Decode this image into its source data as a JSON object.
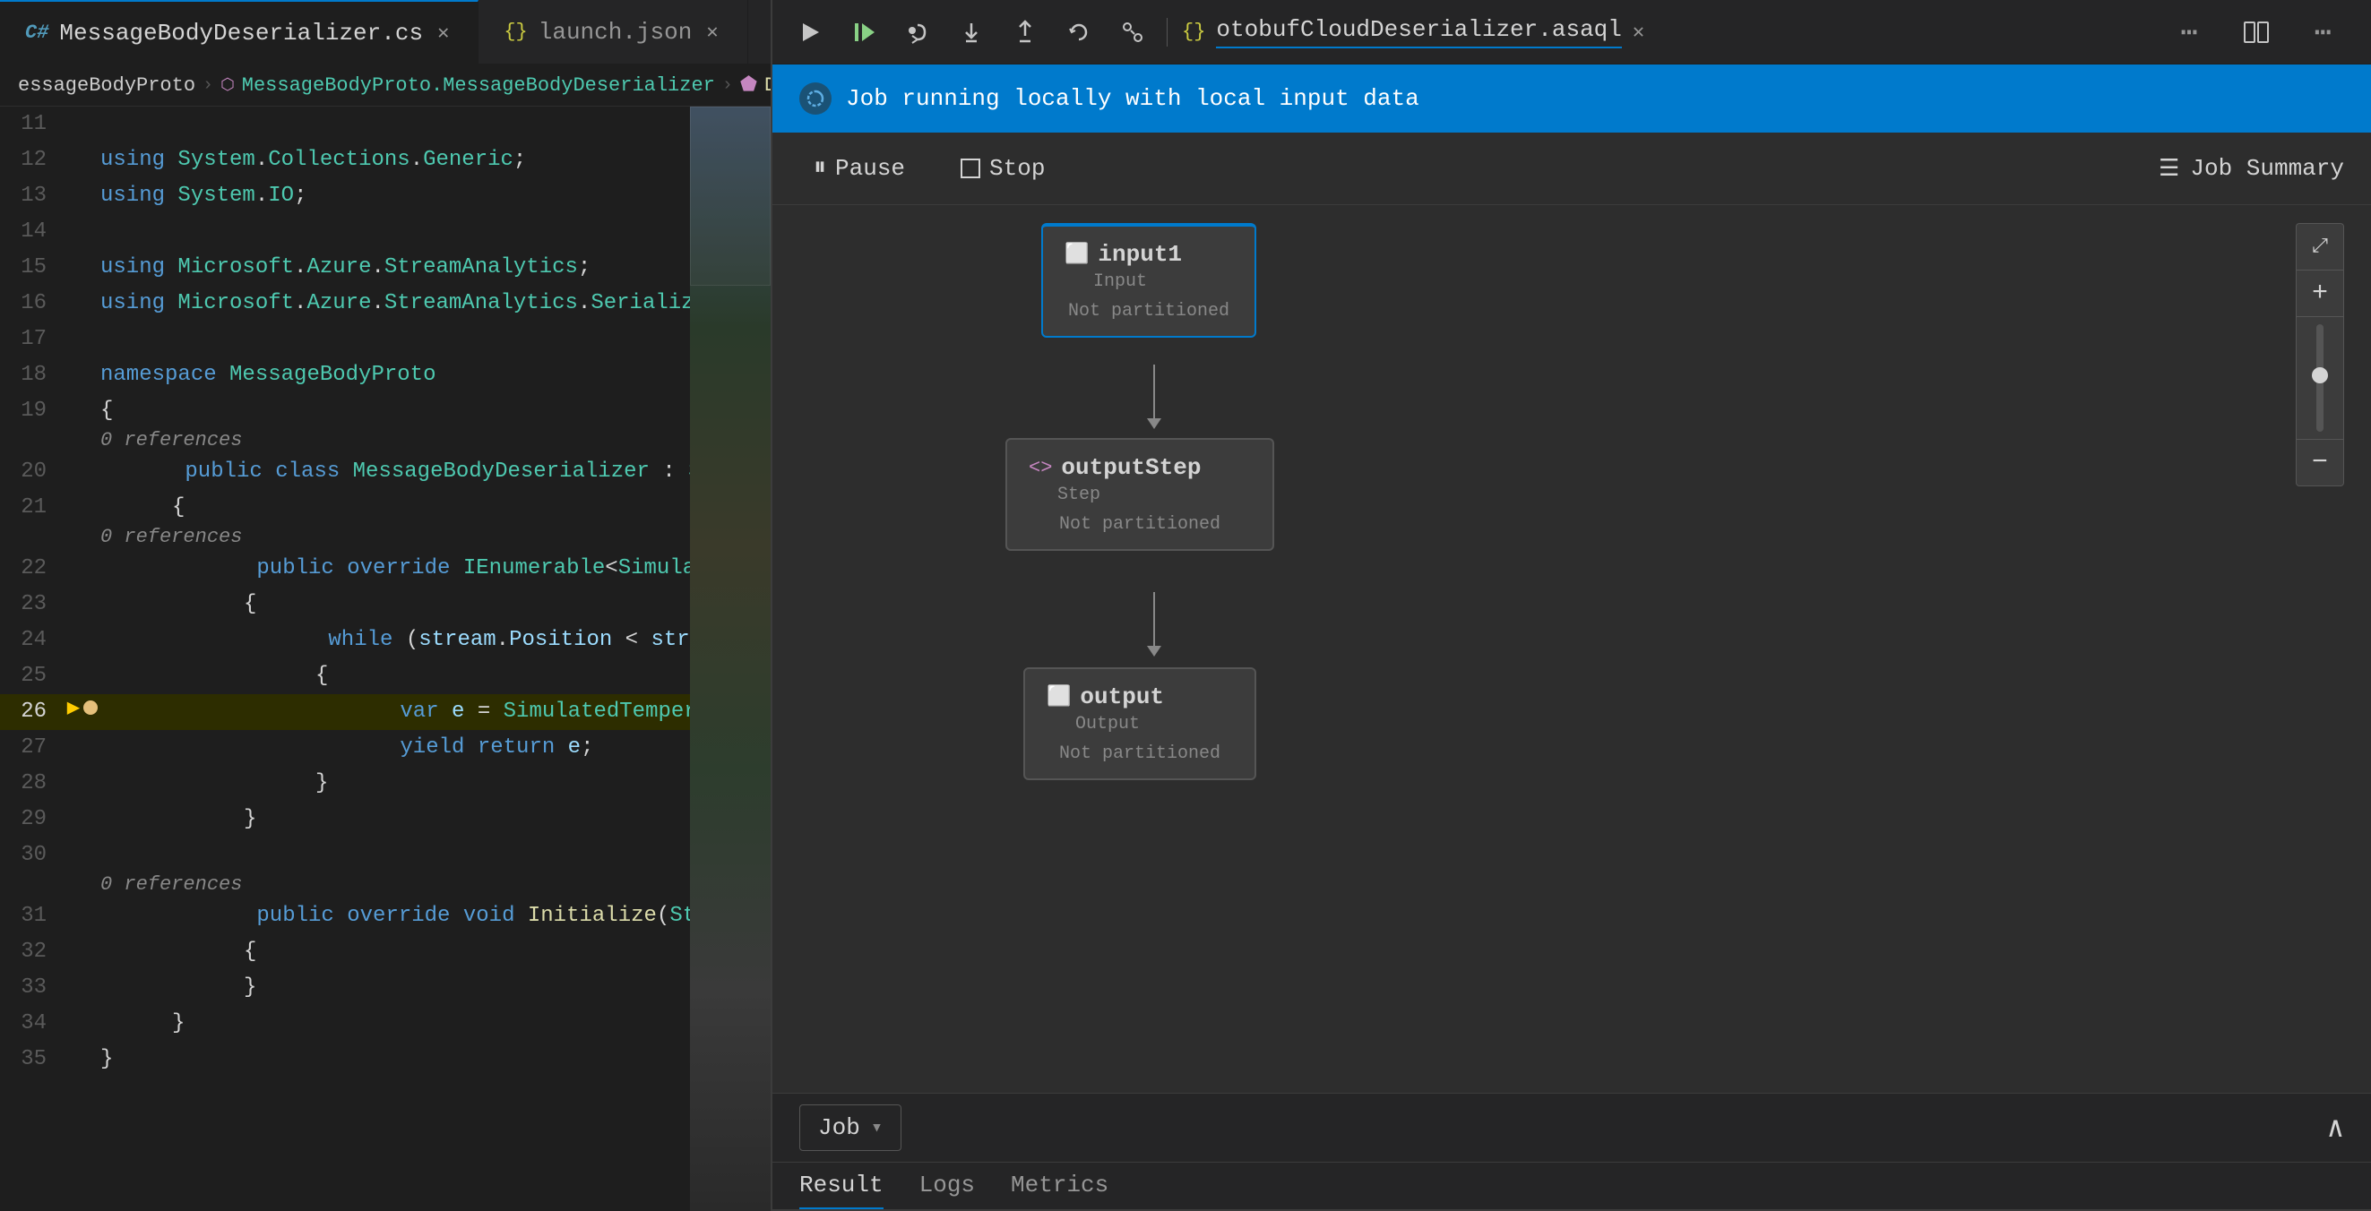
{
  "tabs": {
    "left": [
      {
        "id": "cs-file",
        "icon": "cs",
        "label": "MessageBodyDeserializer.cs",
        "active": true
      },
      {
        "id": "json-file",
        "icon": "json",
        "label": "launch.json",
        "active": false
      }
    ],
    "right": [
      {
        "id": "asaql-file",
        "icon": "asaql",
        "label": "otobufCloudDeserializer.asaql",
        "active": true
      }
    ],
    "more_label": "..."
  },
  "breadcrumb": {
    "parts": [
      {
        "text": "essageBodyProto",
        "type": "plain"
      },
      {
        "text": ">",
        "type": "sep"
      },
      {
        "text": "MessageBodyProto.MessageBodyDeserializer",
        "type": "class"
      },
      {
        "text": ">",
        "type": "sep"
      },
      {
        "text": "Deserialize(Stream stream)",
        "type": "method"
      }
    ]
  },
  "code": {
    "lines": [
      {
        "num": 11,
        "content": "",
        "type": "blank"
      },
      {
        "num": 12,
        "content": "using System.Collections.Generic;",
        "type": "using"
      },
      {
        "num": 13,
        "content": "using System.IO;",
        "type": "using"
      },
      {
        "num": 14,
        "content": "",
        "type": "blank"
      },
      {
        "num": 15,
        "content": "using Microsoft.Azure.StreamAnalytics;",
        "type": "using"
      },
      {
        "num": 16,
        "content": "using Microsoft.Azure.StreamAnalytics.Serialization;",
        "type": "using"
      },
      {
        "num": 17,
        "content": "",
        "type": "blank"
      },
      {
        "num": 18,
        "content": "namespace MessageBodyProto",
        "type": "namespace"
      },
      {
        "num": 19,
        "content": "{",
        "type": "brace"
      },
      {
        "num": 20,
        "content": "    public class MessageBodyDeserializer : StreamDeserializer<Simu",
        "type": "class_decl",
        "hint": "0 references"
      },
      {
        "num": 21,
        "content": "    {",
        "type": "brace"
      },
      {
        "num": 22,
        "content": "        public override IEnumerable<SimulatedTemperatureSensor.Mes",
        "type": "method_decl",
        "hint": "0 references"
      },
      {
        "num": 23,
        "content": "        {",
        "type": "brace"
      },
      {
        "num": 24,
        "content": "            while (stream.Position < stream.Length)",
        "type": "while"
      },
      {
        "num": 25,
        "content": "            {",
        "type": "brace"
      },
      {
        "num": 26,
        "content": "                var e = SimulatedTemperatureSensor.MessageBodyProt",
        "type": "var",
        "highlighted": true,
        "hasBreakpoint": true,
        "hasDebugArrow": true
      },
      {
        "num": 27,
        "content": "                yield return e;",
        "type": "yield"
      },
      {
        "num": 28,
        "content": "            }",
        "type": "brace"
      },
      {
        "num": 29,
        "content": "        }",
        "type": "brace"
      },
      {
        "num": 30,
        "content": "",
        "type": "blank"
      },
      {
        "num": 31,
        "content": "        public override void Initialize(StreamingContext streaming",
        "type": "method_decl",
        "hint": "0 references"
      },
      {
        "num": 32,
        "content": "        {",
        "type": "brace"
      },
      {
        "num": 33,
        "content": "        }",
        "type": "brace"
      },
      {
        "num": 34,
        "content": "    }",
        "type": "brace"
      },
      {
        "num": 35,
        "content": "}",
        "type": "brace"
      }
    ]
  },
  "right_toolbar": {
    "icons": [
      "run",
      "debug-step-over",
      "debug-step-into",
      "debug-step-out",
      "restart",
      "reference"
    ]
  },
  "job_panel": {
    "header": {
      "icon": "refresh",
      "title": "Job running locally with local input data"
    },
    "controls": {
      "pause_label": "Pause",
      "stop_label": "Stop",
      "job_summary_label": "Job Summary"
    },
    "diagram": {
      "nodes": [
        {
          "id": "input1",
          "type": "input",
          "title": "input1",
          "subtitle": "Input",
          "footer": "Not partitioned",
          "icon": "⬜"
        },
        {
          "id": "outputStep",
          "type": "step",
          "title": "outputStep",
          "subtitle": "Step",
          "footer": "Not partitioned",
          "icon": "<>"
        },
        {
          "id": "output",
          "type": "output",
          "title": "output",
          "subtitle": "Output",
          "footer": "Not partitioned",
          "icon": "⬜"
        }
      ]
    },
    "zoom": {
      "expand_title": "⤢",
      "plus_label": "+",
      "minus_label": "−"
    },
    "bottom": {
      "dropdown_label": "Job",
      "tabs": [
        {
          "id": "result",
          "label": "Result",
          "active": true
        },
        {
          "id": "logs",
          "label": "Logs",
          "active": false
        },
        {
          "id": "metrics",
          "label": "Metrics",
          "active": false
        }
      ]
    }
  }
}
